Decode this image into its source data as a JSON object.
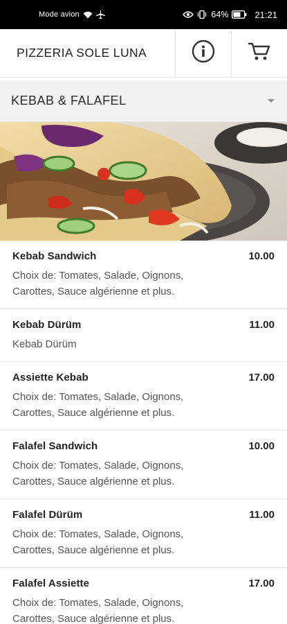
{
  "status_bar": {
    "mode_text": "Mode avion",
    "battery": "64%",
    "time": "21:21"
  },
  "header": {
    "title": "PIZZERIA SOLE LUNA",
    "info_icon": "info-circle-icon",
    "cart_icon": "shopping-cart-icon"
  },
  "category": {
    "selected": "KEBAB & FALAFEL"
  },
  "menu": {
    "items": [
      {
        "name": "Kebab Sandwich",
        "price": "10.00",
        "desc": "Choix de: Tomates, Salade, Oignons, Carottes, Sauce algérienne et plus."
      },
      {
        "name": "Kebab Dürüm",
        "price": "11.00",
        "desc": "Kebab Dürüm"
      },
      {
        "name": "Assiette Kebab",
        "price": "17.00",
        "desc": "Choix de: Tomates, Salade, Oignons, Carottes, Sauce algérienne et plus."
      },
      {
        "name": "Falafel Sandwich",
        "price": "10.00",
        "desc": "Choix de: Tomates, Salade, Oignons, Carottes, Sauce algérienne et plus."
      },
      {
        "name": "Falafel Dürüm",
        "price": "11.00",
        "desc": "Choix de: Tomates, Salade, Oignons, Carottes, Sauce algérienne et plus."
      },
      {
        "name": "Falafel Assiette",
        "price": "17.00",
        "desc": "Choix de: Tomates, Salade, Oignons, Carottes, Sauce algérienne et plus."
      }
    ]
  },
  "colors": {
    "status_bar_bg": "#000000",
    "category_bg": "#f2f2f2",
    "divider": "#e6e6e6"
  }
}
